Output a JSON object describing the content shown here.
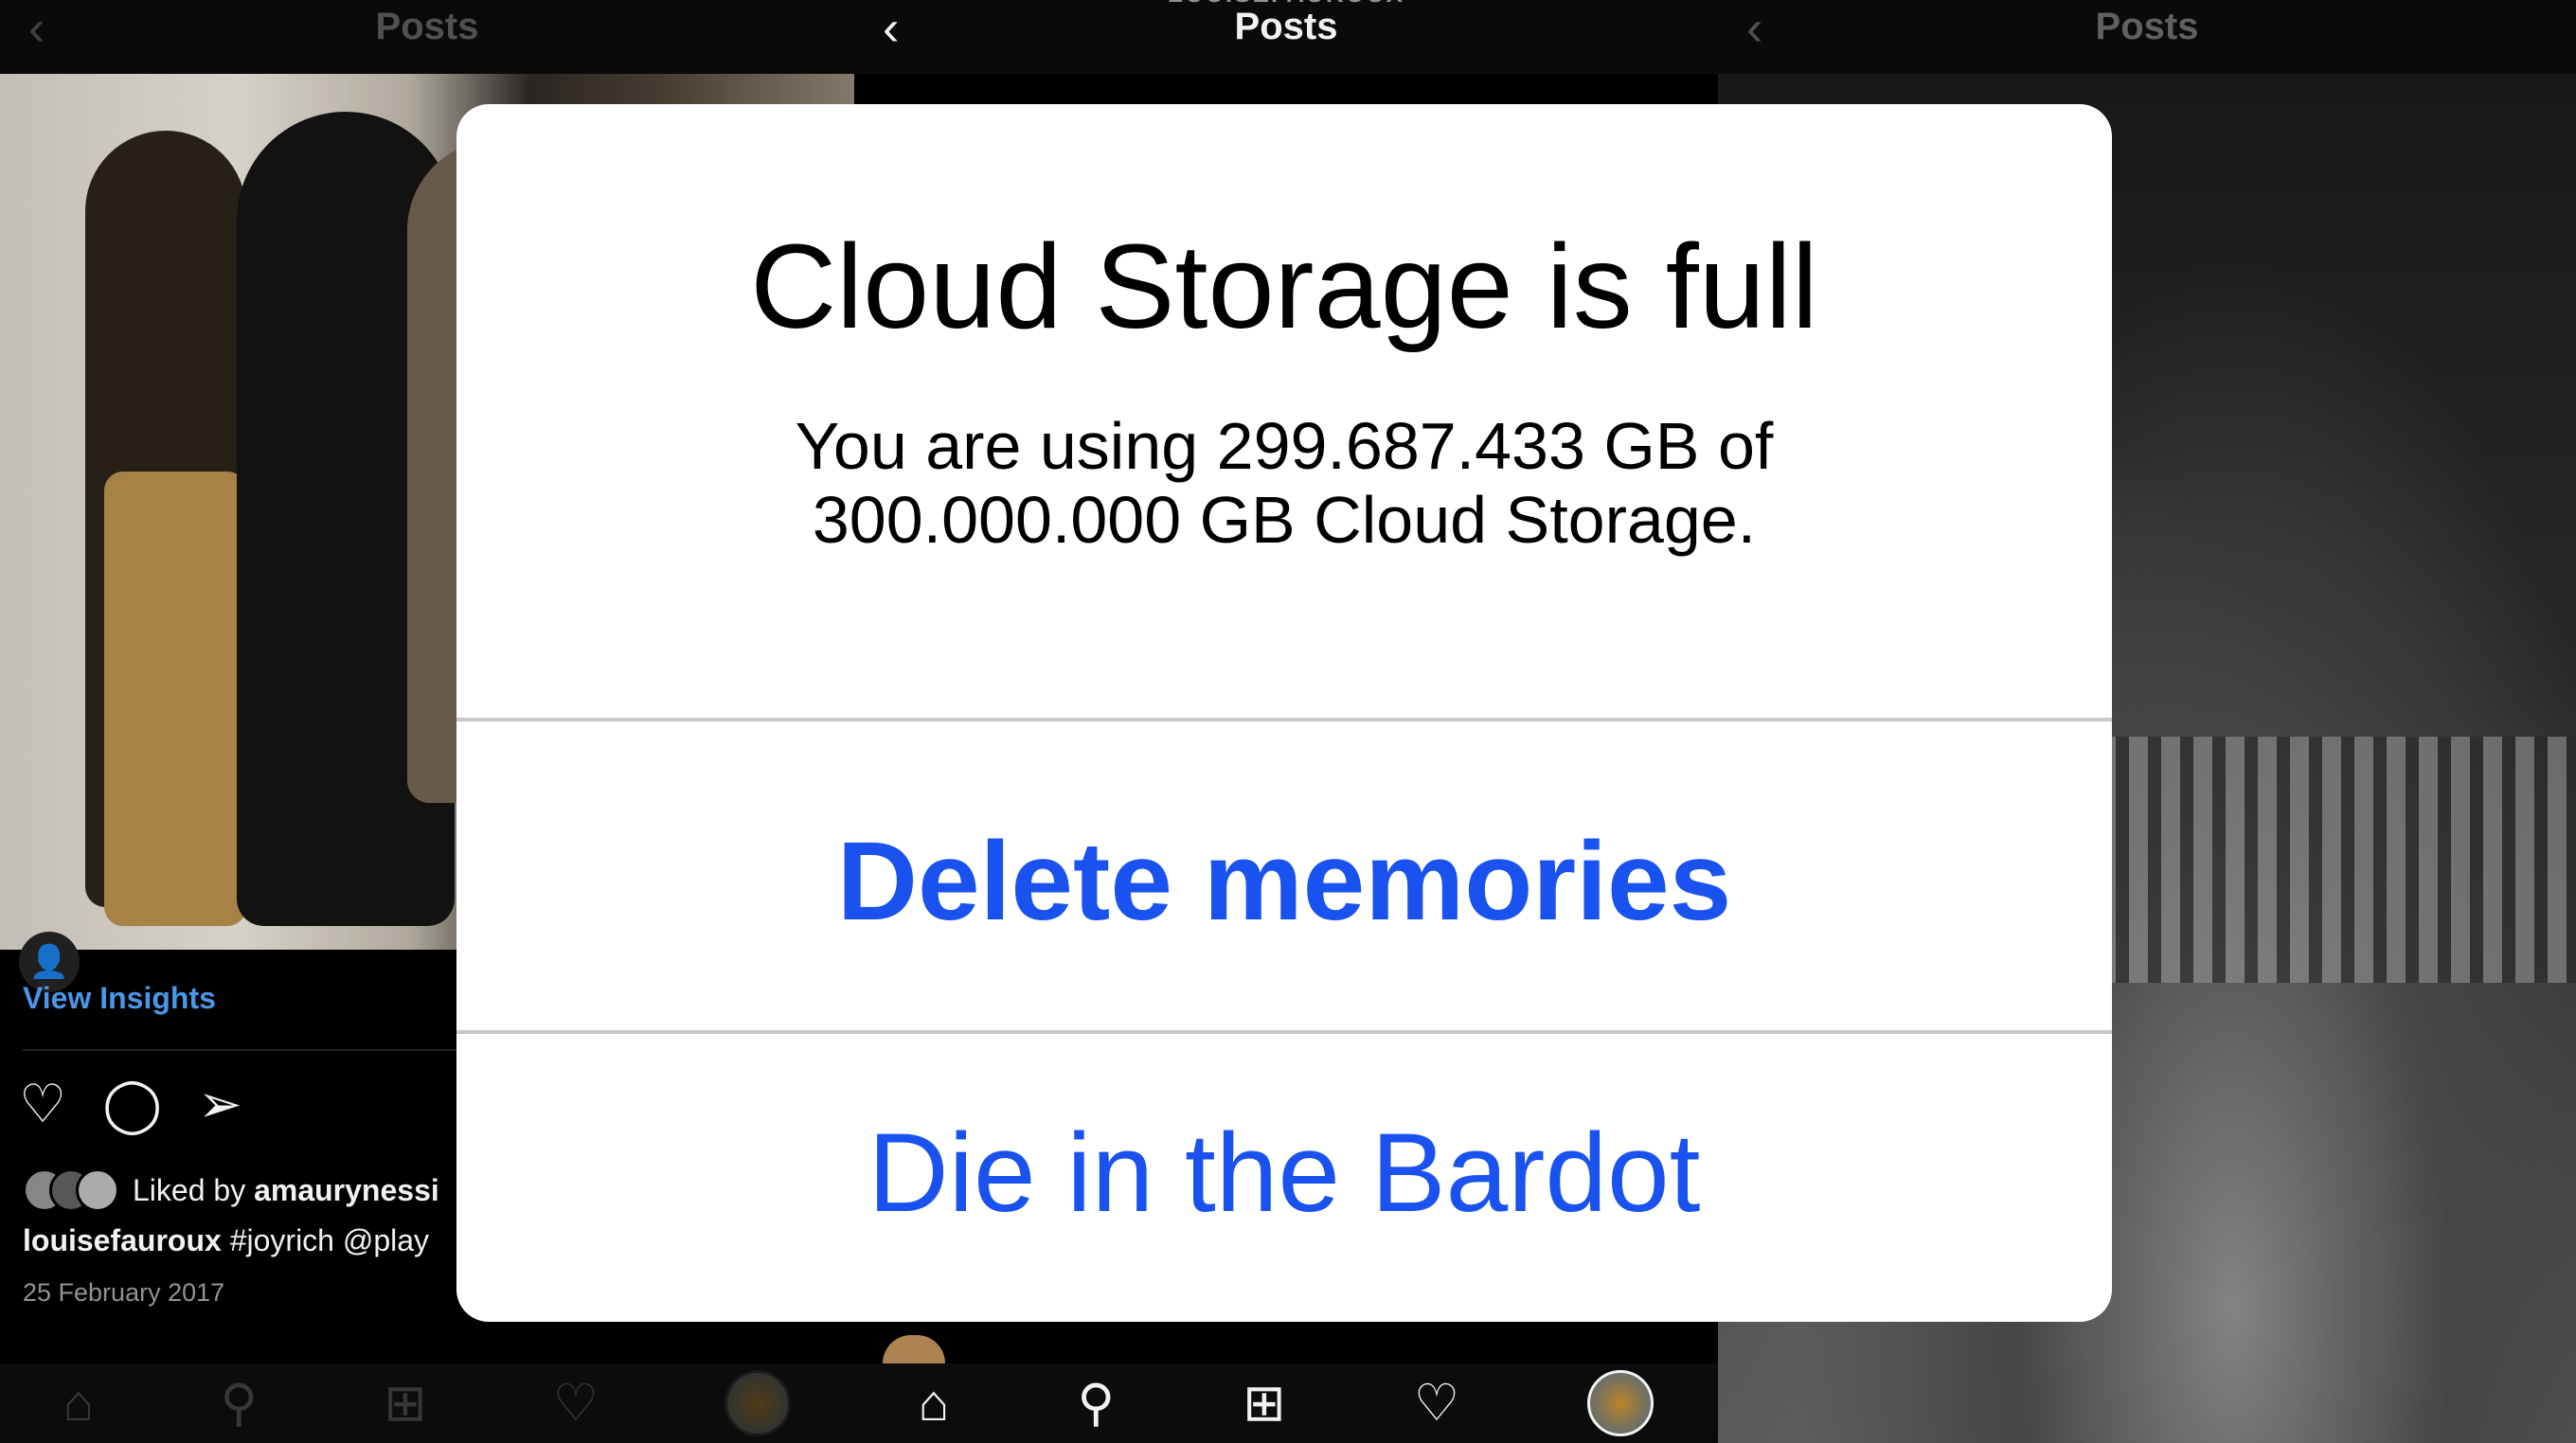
{
  "left": {
    "header_subtitle": "",
    "header_title": "Posts",
    "view_insights": "View Insights",
    "liked_prefix": "Liked by",
    "liked_user": "amaurynessi",
    "caption_user": "louisefauroux",
    "caption_text": "#joyrich @play",
    "date": "25 February 2017",
    "icons": {
      "like": "heart-icon",
      "comment": "comment-icon",
      "share": "send-icon",
      "user_tag": "user-icon"
    }
  },
  "middle": {
    "header_subtitle": "LOUISEFAUROUX",
    "header_title": "Posts",
    "back_icon": "chevron-left-icon",
    "nav": [
      "home-icon",
      "search-icon",
      "add-icon",
      "heart-icon",
      "profile-avatar"
    ]
  },
  "right": {
    "header_title": "Posts",
    "back_icon": "chevron-left-icon"
  },
  "dialog": {
    "title": "Cloud Storage is full",
    "message": "You are using 299.687.433 GB of 300.000.000 GB Cloud Storage.",
    "primary_button": "Delete memories",
    "secondary_button": "Die in the Bardot",
    "accent_color": "#1a52f0"
  }
}
